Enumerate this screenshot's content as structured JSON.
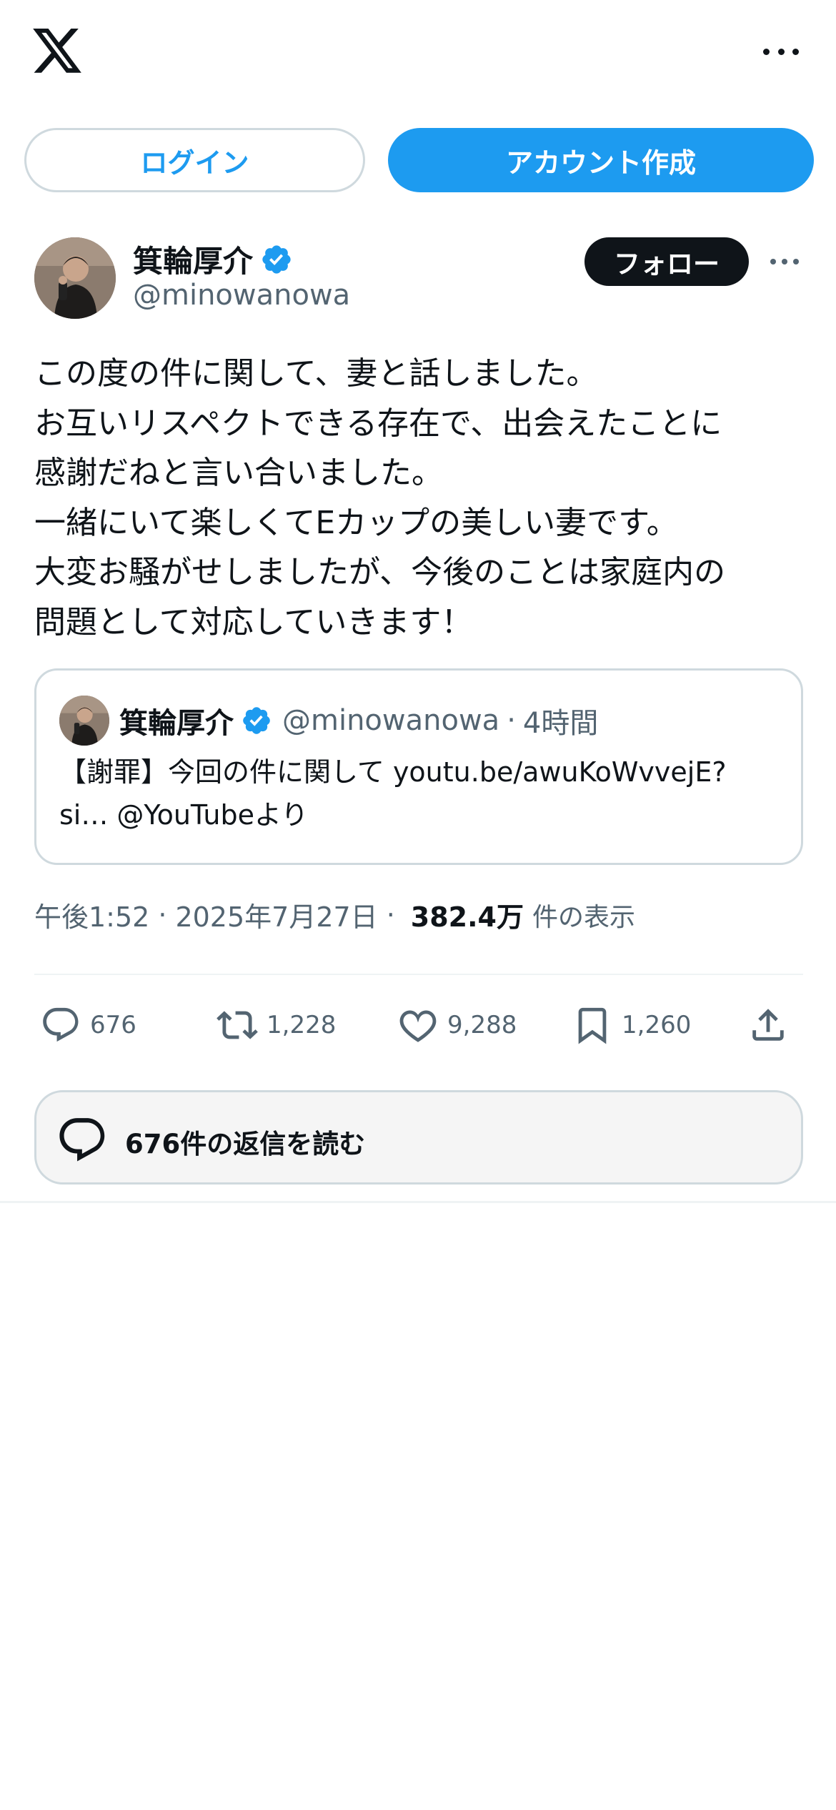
{
  "header": {
    "logo_icon": "x-logo-icon",
    "more_icon": "more-horizontal-icon"
  },
  "auth": {
    "login_label": "ログイン",
    "signup_label": "アカウント作成"
  },
  "author": {
    "display_name": "箕輪厚介",
    "handle": "@minowanowa",
    "verified_icon": "verified-badge-icon",
    "follow_label": "フォロー"
  },
  "tweet": {
    "lines": [
      "この度の件に関して、妻と話しました。",
      "お互いリスペクトできる存在で、出会えたことに",
      "感謝だねと言い合いました。",
      "一緒にいて楽しくてEカップの美しい妻です。",
      "大変お騒がせしましたが、今後のことは家庭内の",
      "問題として対応していきます！"
    ]
  },
  "quote": {
    "display_name": "箕輪厚介",
    "handle": "@minowanowa",
    "separator": "·",
    "time": "4時間",
    "lines": [
      "【謝罪】今回の件に関して youtu.be/awuKoWvvejE?",
      "si… @YouTubeより"
    ]
  },
  "meta": {
    "time": "午後1:52",
    "separator": "·",
    "date": "2025年7月27日",
    "views_count": "382.4万",
    "views_label": "件の表示"
  },
  "actions": {
    "reply_count": "676",
    "retweet_count": "1,228",
    "like_count": "9,288",
    "bookmark_count": "1,260"
  },
  "replies": {
    "label": "676件の返信を読む"
  },
  "colors": {
    "accent": "#1d9bf0",
    "text_primary": "#0f1419",
    "text_secondary": "#536471",
    "border": "#cfd9de"
  }
}
